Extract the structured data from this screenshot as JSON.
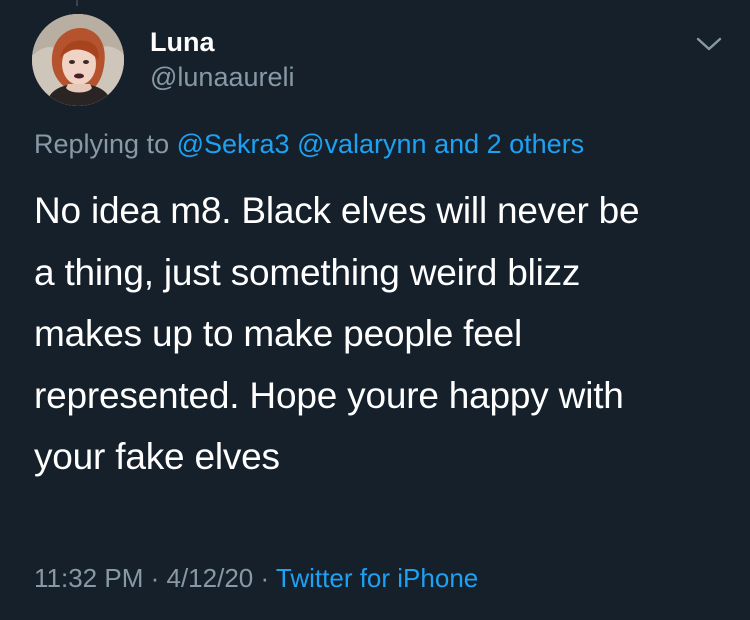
{
  "author": {
    "display_name": "Luna",
    "handle": "@lunaaureli"
  },
  "reply": {
    "prefix": "Replying to",
    "mentions": [
      "@Sekra3",
      "@valarynn"
    ],
    "others": "and 2 others"
  },
  "tweet": {
    "lines": [
      "No idea m8. Black elves will never be",
      "a thing, just something weird blizz",
      "makes up to make people feel",
      "represented. Hope youre happy with",
      "your fake elves"
    ]
  },
  "meta": {
    "time": "11:32 PM",
    "separator": "·",
    "date": "4/12/20",
    "source": "Twitter for iPhone"
  },
  "icons": {
    "caret": "chevron-down-icon"
  },
  "colors": {
    "background": "#15202b",
    "text": "#ffffff",
    "muted": "#8899a6",
    "accent": "#1da1f2"
  }
}
